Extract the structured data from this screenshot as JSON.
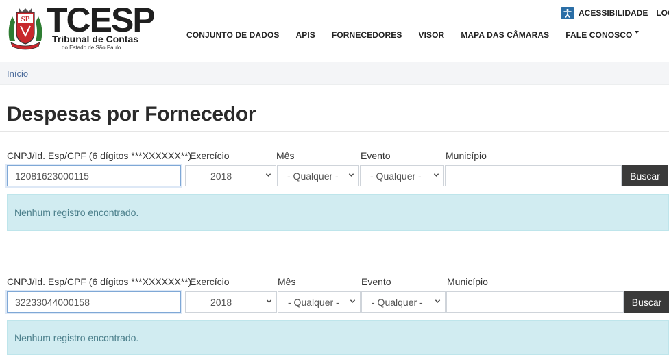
{
  "header": {
    "brand": "TCESP",
    "brand_sub": "Tribunal de Contas",
    "brand_sub2": "do Estado de São Paulo",
    "nav": [
      {
        "label": "CONJUNTO DE DADOS"
      },
      {
        "label": "APIS"
      },
      {
        "label": "FORNECEDORES"
      },
      {
        "label": "VISOR"
      },
      {
        "label": "MAPA DAS CÂMARAS"
      },
      {
        "label": "FALE CONOSCO"
      }
    ],
    "accessibility": "ACESSIBILIDADE",
    "login": "LOGIN"
  },
  "breadcrumb": {
    "home": "Início"
  },
  "page": {
    "title": "Despesas por Fornecedor"
  },
  "labels": {
    "cnpj": "CNPJ/Id. Esp/CPF (6 dígitos ***XXXXXX**)",
    "exercicio": "Exercício",
    "mes": "Mês",
    "evento": "Evento",
    "municipio": "Município",
    "buscar": "Buscar"
  },
  "forms": [
    {
      "cnpj_value": "12081623000115",
      "exercicio": "2018",
      "mes": "- Qualquer -",
      "evento": "- Qualquer -",
      "municipio": "",
      "message": "Nenhum registro encontrado."
    },
    {
      "cnpj_value": "32233044000158",
      "exercicio": "2018",
      "mes": "- Qualquer -",
      "evento": "- Qualquer -",
      "municipio": "",
      "message": "Nenhum registro encontrado."
    }
  ],
  "colors": {
    "alert_bg": "#d1ecf1",
    "button_bg": "#3a3a3a",
    "accessibility_blue": "#2b6ea6",
    "seal_red": "#c8282d"
  }
}
